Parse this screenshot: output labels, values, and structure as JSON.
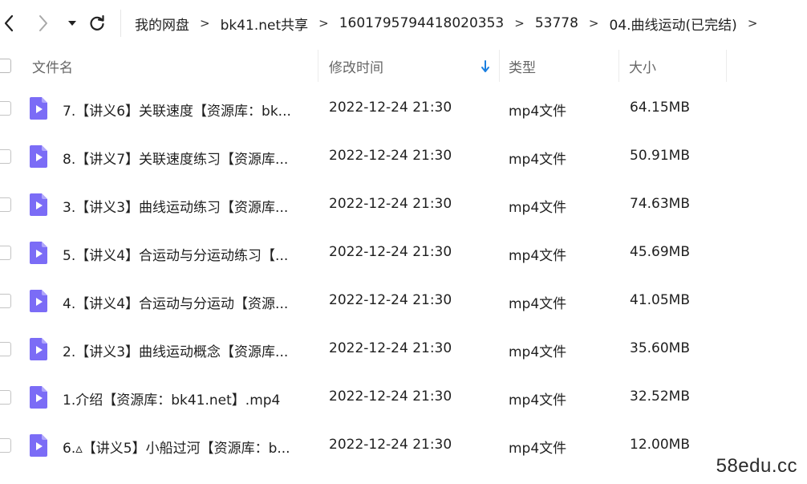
{
  "nav": {
    "back_icon": "chevron-left-icon",
    "forward_icon": "chevron-right-icon",
    "history_icon": "caret-down-icon",
    "refresh_icon": "refresh-icon"
  },
  "breadcrumb": [
    "我的网盘",
    "bk41.net共享",
    "1601795794418020353",
    "53778",
    "04.曲线运动(已完结)"
  ],
  "breadcrumb_separator": ">",
  "columns": {
    "name": "文件名",
    "time": "修改时间",
    "type": "类型",
    "size": "大小"
  },
  "sort_icon": "arrow-down-icon",
  "accent_color": "#1a7fe0",
  "file_icon_color": "#7b6cf6",
  "files": [
    {
      "name": "7.【讲义6】关联速度【资源库：bk...",
      "time": "2022-12-24 21:30",
      "type": "mp4文件",
      "size": "64.15MB"
    },
    {
      "name": "8.【讲义7】关联速度练习【资源库...",
      "time": "2022-12-24 21:30",
      "type": "mp4文件",
      "size": "50.91MB"
    },
    {
      "name": "3.【讲义3】曲线运动练习【资源库...",
      "time": "2022-12-24 21:30",
      "type": "mp4文件",
      "size": "74.63MB"
    },
    {
      "name": "5.【讲义4】合运动与分运动练习【...",
      "time": "2022-12-24 21:30",
      "type": "mp4文件",
      "size": "45.69MB"
    },
    {
      "name": "4.【讲义4】合运动与分运动【资源...",
      "time": "2022-12-24 21:30",
      "type": "mp4文件",
      "size": "41.05MB"
    },
    {
      "name": "2.【讲义3】曲线运动概念【资源库...",
      "time": "2022-12-24 21:30",
      "type": "mp4文件",
      "size": "35.60MB"
    },
    {
      "name": "1.介绍【资源库：bk41.net】.mp4",
      "time": "2022-12-24 21:30",
      "type": "mp4文件",
      "size": "32.52MB"
    },
    {
      "name": "6.▵【讲义5】小船过河【资源库：b...",
      "time": "2022-12-24 21:30",
      "type": "mp4文件",
      "size": "12.00MB"
    }
  ],
  "watermark": "58edu.cc"
}
